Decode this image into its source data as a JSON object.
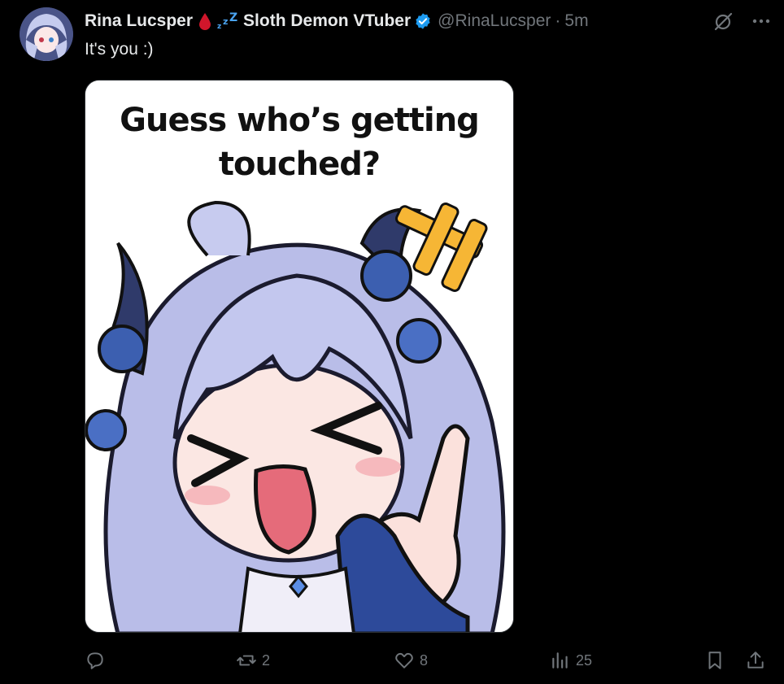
{
  "post": {
    "display_name": "Rina Lucsper",
    "name_emoji": "🩸💤",
    "name_suffix": "Sloth Demon VTuber",
    "handle": "@RinaLucsper",
    "separator": "·",
    "time": "5m",
    "text": "It's you :)",
    "media_caption_line1": "Guess who’s getting",
    "media_caption_line2": "touched?"
  },
  "actions": {
    "reposts": "2",
    "likes": "8",
    "views": "25"
  },
  "colors": {
    "background": "#000000",
    "text": "#e7e9ea",
    "muted": "#71767b",
    "verified": "#1d9bf0"
  },
  "icons": [
    "verified-badge-icon",
    "grok-icon",
    "more-icon",
    "reply-icon",
    "repost-icon",
    "like-icon",
    "views-icon",
    "bookmark-icon",
    "share-icon"
  ]
}
